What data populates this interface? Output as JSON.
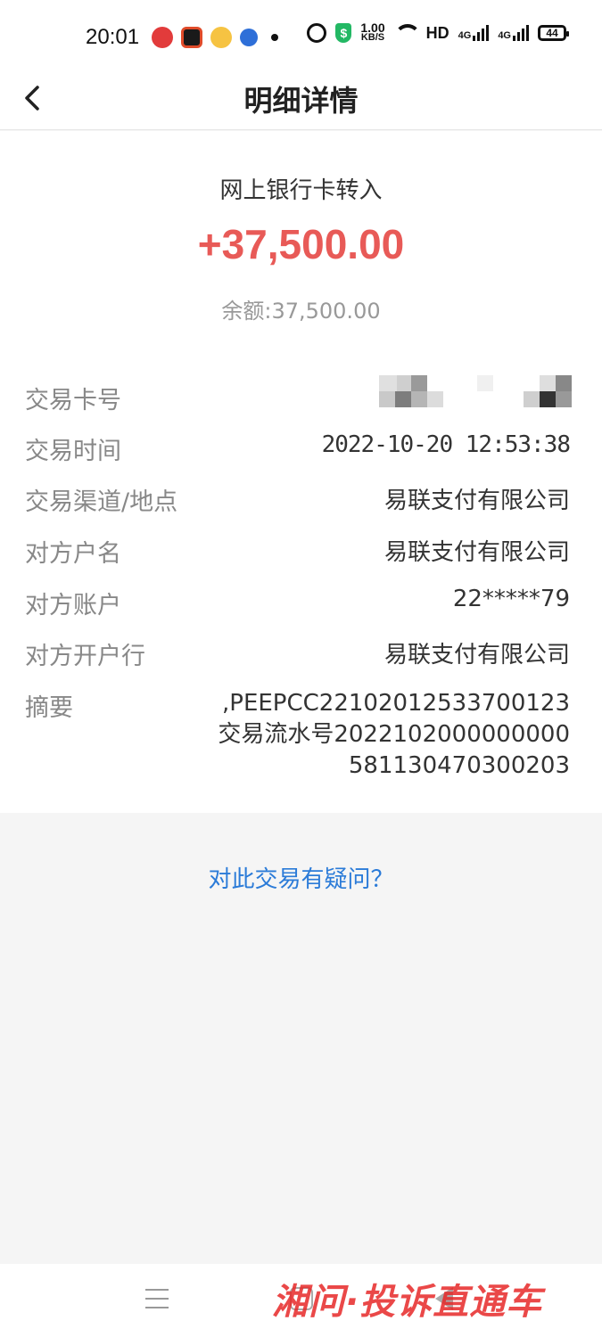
{
  "status_bar": {
    "time": "20:01",
    "net_speed_value": "1.00",
    "net_speed_unit": "KB/S",
    "hd": "HD",
    "signal_1": "4G",
    "signal_2": "4G",
    "battery": "44"
  },
  "header": {
    "title": "明细详情"
  },
  "transaction": {
    "type": "网上银行卡转入",
    "amount": "+37,500.00",
    "balance": "余额:37,500.00"
  },
  "details": [
    {
      "label": "交易卡号",
      "value": ""
    },
    {
      "label": "交易时间",
      "value": "2022-10-20 12:53:38"
    },
    {
      "label": "交易渠道/地点",
      "value": "易联支付有限公司"
    },
    {
      "label": "对方户名",
      "value": "易联支付有限公司"
    },
    {
      "label": "对方账户",
      "value": "22*****79"
    },
    {
      "label": "对方开户行",
      "value": "易联支付有限公司"
    },
    {
      "label": "摘要",
      "value": ",PEEPCC22102012533700123 交易流水号2022102000000000581130470300203"
    }
  ],
  "links": {
    "question": "对此交易有疑问？"
  },
  "watermark": {
    "left": "湘问",
    "sep": "·",
    "right": "投诉直通车"
  },
  "colors": {
    "amount": "#e85a57",
    "link": "#2b7bd8",
    "label": "#888888"
  }
}
